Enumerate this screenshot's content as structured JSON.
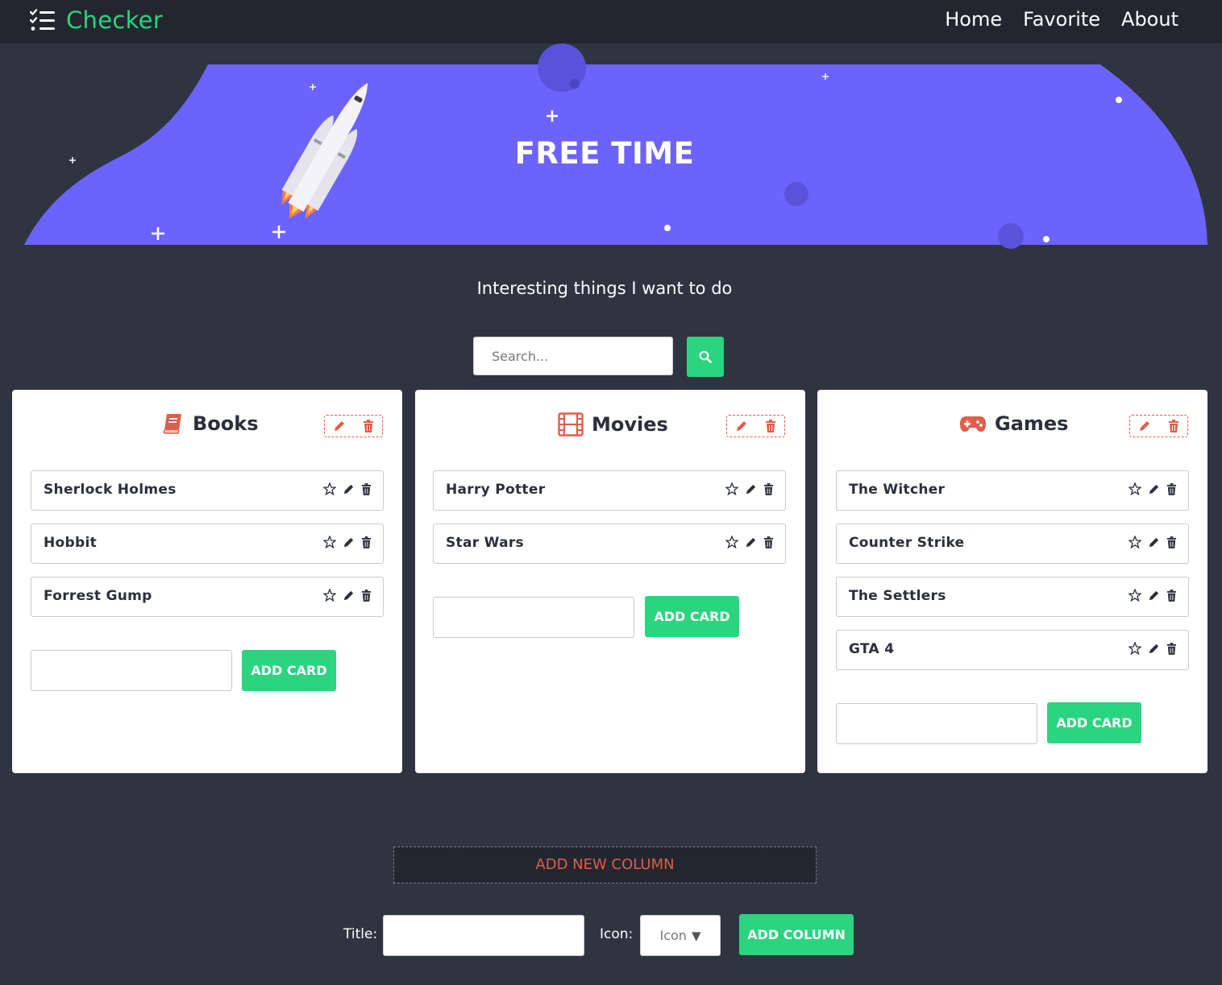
{
  "app": {
    "name": "Checker"
  },
  "nav": {
    "links": [
      "Home",
      "Favorite",
      "About"
    ]
  },
  "hero": {
    "title": "FREE TIME"
  },
  "subtitle": "Interesting things I want to do",
  "search": {
    "placeholder": "Search..."
  },
  "columns": [
    {
      "title": "Books",
      "icon": "book-icon",
      "cards": [
        "Sherlock Holmes",
        "Hobbit",
        "Forrest Gump"
      ],
      "add_label": "ADD CARD"
    },
    {
      "title": "Movies",
      "icon": "film-icon",
      "cards": [
        "Harry Potter",
        "Star Wars"
      ],
      "add_label": "ADD CARD"
    },
    {
      "title": "Games",
      "icon": "gamepad-icon",
      "cards": [
        "The Witcher",
        "Counter Strike",
        "The Settlers",
        "GTA 4"
      ],
      "add_label": "ADD CARD"
    }
  ],
  "add_column": {
    "toggle_label": "ADD NEW COLUMN",
    "title_label": "Title:",
    "icon_label": "Icon:",
    "icon_select_value": "Icon",
    "submit_label": "ADD COLUMN"
  },
  "colors": {
    "accent": "#2bd47f",
    "danger": "#e05d4a",
    "hero": "#6c63ff",
    "background": "#2f3441",
    "navbar": "#23262e"
  }
}
